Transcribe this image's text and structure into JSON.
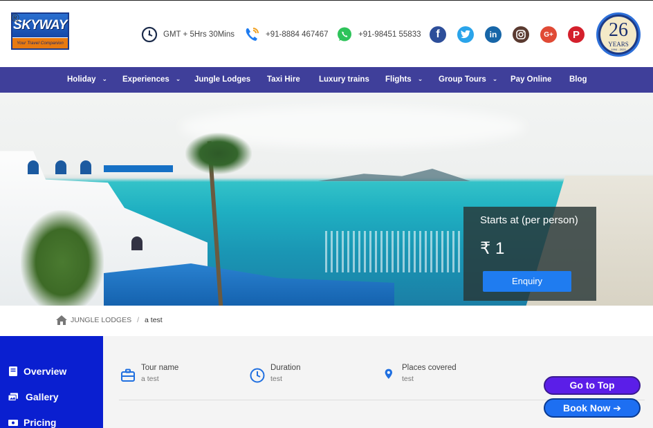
{
  "header": {
    "logo_text": "SKYWAY",
    "logo_tagline": "Your Travel Companion",
    "logo_reg": "®",
    "timezone": "GMT + 5Hrs 30Mins",
    "phone": "+91-8884 467467",
    "whatsapp": "+91-98451 55833",
    "social": [
      {
        "name": "facebook",
        "glyph": "f",
        "color": "#2d4e9a"
      },
      {
        "name": "twitter",
        "glyph": "t",
        "color": "#2aa4ea"
      },
      {
        "name": "linkedin",
        "glyph": "in",
        "color": "#1766a8"
      },
      {
        "name": "instagram",
        "glyph": "◎",
        "color": "#5a3a30"
      },
      {
        "name": "google-plus",
        "glyph": "G+",
        "color": "#e04a35"
      },
      {
        "name": "pinterest",
        "glyph": "P",
        "color": "#d4202c"
      }
    ],
    "anniversary": {
      "number": "26",
      "label": "YEARS",
      "dates": "1994 - 2020"
    }
  },
  "nav": {
    "items": [
      {
        "label": "Holiday",
        "dropdown": true
      },
      {
        "label": "Experiences",
        "dropdown": true
      },
      {
        "label": "Jungle Lodges",
        "dropdown": false
      },
      {
        "label": "Taxi Hire",
        "dropdown": false
      },
      {
        "label": "Luxury trains",
        "dropdown": false
      },
      {
        "label": "Flights",
        "dropdown": true
      },
      {
        "label": "Group Tours",
        "dropdown": true
      },
      {
        "label": "Pay Online",
        "dropdown": false
      },
      {
        "label": "Blog",
        "dropdown": false
      }
    ],
    "chevron": "⌄"
  },
  "hero": {
    "price_label": "Starts at (per person)",
    "price_value": "₹ 1",
    "enquiry_label": "Enquiry"
  },
  "breadcrumb": {
    "parent": "JUNGLE LODGES",
    "separator": "/",
    "current": "a test"
  },
  "sidebar": {
    "items": [
      {
        "label": "Overview",
        "icon": "book-icon"
      },
      {
        "label": "Gallery",
        "icon": "gallery-icon"
      },
      {
        "label": "Pricing",
        "icon": "money-icon"
      }
    ]
  },
  "tour": {
    "name_label": "Tour name",
    "name_value": "a test",
    "duration_label": "Duration",
    "duration_value": "test",
    "places_label": "Places covered",
    "places_value": "test"
  },
  "floating": {
    "go_top": "Go to Top",
    "book_now": "Book Now",
    "book_arrow": "➔"
  },
  "colors": {
    "nav_bg": "#3f3f9a",
    "sidebar_bg": "#0a1fd0",
    "enquiry_bg": "#1f7cf0",
    "go_top_bg": "#5b1ee8",
    "book_now_bg": "#1d6ff2"
  }
}
